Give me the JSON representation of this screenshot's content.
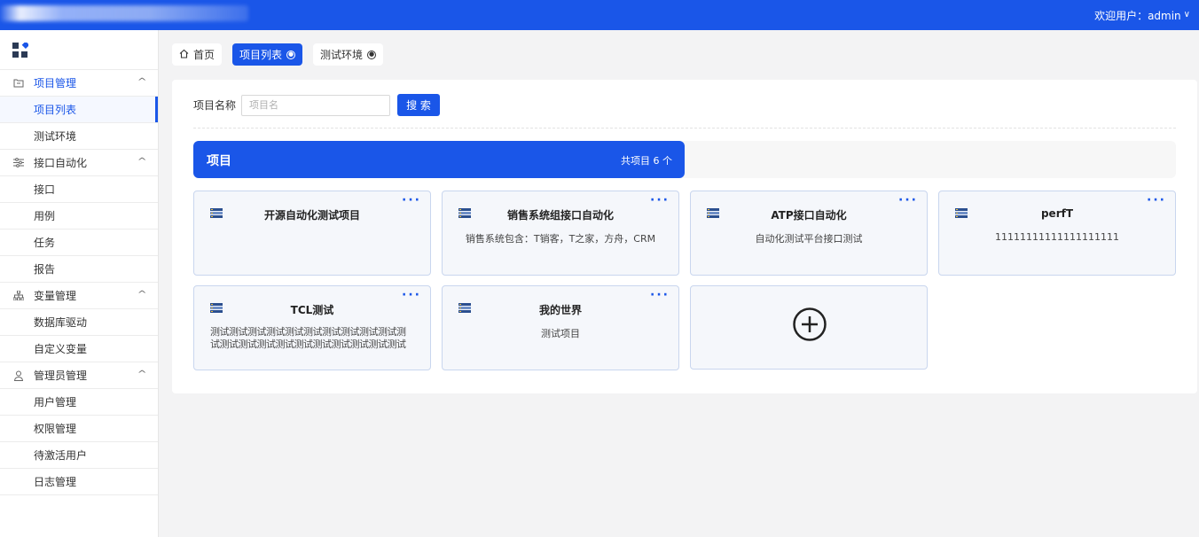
{
  "header": {
    "user_label": "欢迎用户：admin"
  },
  "sidebar": {
    "groups": [
      {
        "label": "项目管理",
        "icon": "folder-icon",
        "items": [
          "项目列表",
          "测试环境"
        ]
      },
      {
        "label": "接口自动化",
        "icon": "sliders-icon",
        "items": [
          "接口",
          "用例",
          "任务",
          "报告"
        ]
      },
      {
        "label": "变量管理",
        "icon": "sitemap-icon",
        "items": [
          "数据库驱动",
          "自定义变量"
        ]
      },
      {
        "label": "管理员管理",
        "icon": "user-icon",
        "items": [
          "用户管理",
          "权限管理",
          "待激活用户",
          "日志管理"
        ]
      }
    ],
    "active_item": "项目列表"
  },
  "tabs": [
    {
      "label": "首页",
      "icon": "home-icon",
      "closable": false,
      "active": false
    },
    {
      "label": "项目列表",
      "closable": true,
      "active": true
    },
    {
      "label": "测试环境",
      "closable": true,
      "active": false
    }
  ],
  "search": {
    "label": "项目名称",
    "placeholder": "项目名",
    "value": "",
    "button_label": "搜 索"
  },
  "banner": {
    "title": "项目",
    "count_label": "共项目 6 个"
  },
  "projects": [
    {
      "name": "开源自动化测试项目",
      "description": ""
    },
    {
      "name": "销售系统组接口自动化",
      "description": "销售系统包含：T销客，T之家，方舟，CRM"
    },
    {
      "name": "ATP接口自动化",
      "description": "自动化测试平台接口测试"
    },
    {
      "name": "perfT",
      "description": "11111111111111111111"
    },
    {
      "name": "TCL测试",
      "description": "测试测试测试测试测试测试测试测试测试测试测试测试测试测试测试测试测试测试测试测试测试测试测试测试测试测试测试测试测试测试测试测试测试测试测试测试测试测试测试测试测试测试测试"
    },
    {
      "name": "我的世界",
      "description": "测试项目"
    }
  ],
  "colors": {
    "primary": "#1a56e8",
    "card_bg": "#f5f7fb",
    "card_border": "#c9d6ee",
    "page_bg": "#f3f3f4"
  }
}
